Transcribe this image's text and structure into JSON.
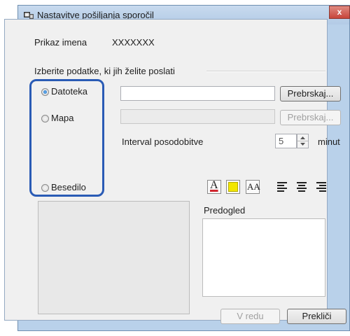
{
  "window": {
    "title": "Nastavitve pošiljanja sporočil",
    "close_glyph": "x"
  },
  "display_name": {
    "label": "Prikaz imena",
    "value": "XXXXXXX"
  },
  "section_title": "Izberite podatke, ki jih želite poslati",
  "options": {
    "file_label": "Datoteka",
    "folder_label": "Mapa",
    "text_label": "Besedilo",
    "selected": "Datoteka"
  },
  "browse_file_label": "Prebrskaj...",
  "browse_folder_label": "Prebrskaj...",
  "interval": {
    "label": "Interval posodobitve",
    "value": "5",
    "unit": "minut"
  },
  "format_toolbar": {
    "font_color_glyph": "A",
    "font_size_glyph": "AA",
    "text_color": "#d0262f",
    "highlight_color": "#f2e600"
  },
  "preview_label": "Predogled",
  "ok_label": "V redu",
  "cancel_label": "Prekliči",
  "highlight_box_color": "#2a5bb5"
}
